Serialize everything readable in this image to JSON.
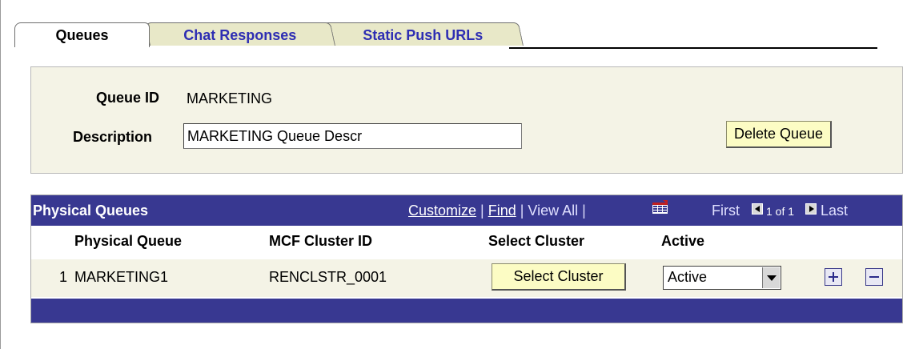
{
  "tabs": [
    {
      "label": "Queues",
      "active": true
    },
    {
      "label": "Chat Responses",
      "active": false
    },
    {
      "label": "Static Push URLs",
      "active": false
    }
  ],
  "queue": {
    "id_label": "Queue ID",
    "id_value": "MARKETING",
    "description_label": "Description",
    "description_value": "MARKETING Queue Descr",
    "delete_button": "Delete Queue"
  },
  "grid": {
    "title": "Physical Queues",
    "customize": "Customize",
    "find": "Find",
    "view_all": "View All",
    "first": "First",
    "count": "1 of 1",
    "last": "Last",
    "grid_icon": "grid-icon",
    "columns": [
      "Physical Queue",
      "MCF Cluster ID",
      "Select Cluster",
      "Active"
    ],
    "rows": [
      {
        "num": "1",
        "queue": "MARKETING1",
        "cluster_id": "RENCLSTR_0001",
        "select_button": "Select Cluster",
        "active": "Active"
      }
    ]
  },
  "colors": {
    "header_bar": "#383891",
    "panel_bg": "#f4f3e6",
    "button_bg": "#fcfcc4",
    "tab_link": "#2e2eb3"
  }
}
